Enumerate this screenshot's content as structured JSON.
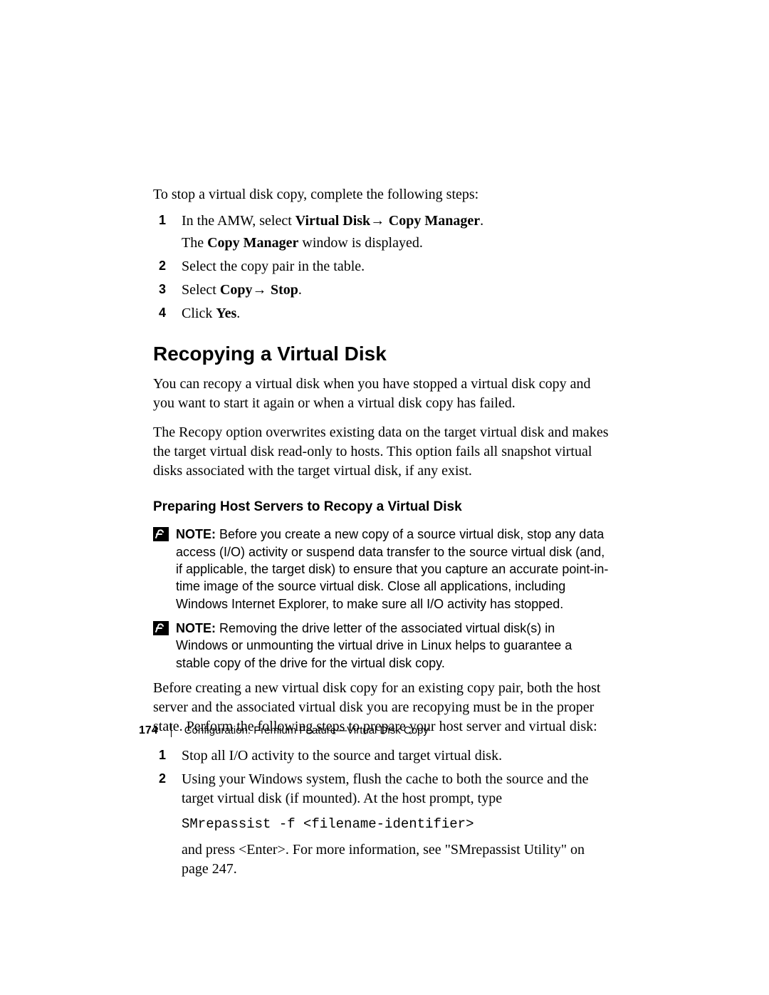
{
  "intro": "To stop a virtual disk copy, complete the following steps:",
  "steps_top": [
    {
      "num": "1",
      "runs": [
        {
          "t": "In the AMW, select "
        },
        {
          "t": "Virtual Disk",
          "b": true
        },
        {
          "t": "→ ",
          "arrow": true
        },
        {
          "t": "Copy Manager",
          "b": true
        },
        {
          "t": "."
        }
      ],
      "tail": [
        {
          "t": "The "
        },
        {
          "t": "Copy Manager",
          "b": true
        },
        {
          "t": " window is displayed."
        }
      ]
    },
    {
      "num": "2",
      "runs": [
        {
          "t": "Select the copy pair in the table."
        }
      ]
    },
    {
      "num": "3",
      "runs": [
        {
          "t": "Select "
        },
        {
          "t": "Copy",
          "b": true
        },
        {
          "t": "→ ",
          "arrow": true
        },
        {
          "t": "Stop",
          "b": true
        },
        {
          "t": "."
        }
      ]
    },
    {
      "num": "4",
      "runs": [
        {
          "t": "Click "
        },
        {
          "t": "Yes",
          "b": true
        },
        {
          "t": "."
        }
      ]
    }
  ],
  "h2": "Recopying a Virtual Disk",
  "p1": "You can recopy a virtual disk when you have stopped a virtual disk copy and you want to start it again or when a virtual disk copy has failed.",
  "p2": "The Recopy option overwrites existing data on the target virtual disk and makes the target virtual disk read-only to hosts. This option fails all snapshot virtual disks associated with the target virtual disk, if any exist.",
  "h3": "Preparing Host Servers to Recopy a Virtual Disk",
  "note1_lead": "NOTE:",
  "note1_body": " Before you create a new copy of a source virtual disk, stop any data access (I/O) activity or suspend data transfer to the source virtual disk (and, if applicable, the target disk) to ensure that you capture an accurate point-in-time image of the source virtual disk. Close all applications, including Windows Internet Explorer, to make sure all I/O activity has stopped.",
  "note2_lead": "NOTE:",
  "note2_body": " Removing the drive letter of the associated virtual disk(s) in Windows or unmounting the virtual drive in Linux helps to guarantee a stable copy of the drive for the virtual disk copy.",
  "p3": "Before creating a new virtual disk copy for an existing copy pair, both the host server and the associated virtual disk you are recopying must be in the proper state. Perform the following steps to prepare your host server and virtual disk:",
  "steps_bottom": [
    {
      "num": "1",
      "runs": [
        {
          "t": "Stop all I/O activity to the source and target virtual disk."
        }
      ]
    },
    {
      "num": "2",
      "runs": [
        {
          "t": "Using your Windows system, flush the cache to both the source and the target virtual disk (if mounted). At the host prompt, type"
        }
      ],
      "code": "SMrepassist -f <filename-identifier>",
      "after": "and press <Enter>. For more information, see \"SMrepassist Utility\" on page 247."
    }
  ],
  "footer": {
    "page": "174",
    "text": "Configuration: Premium Feature—Virtual Disk Copy"
  }
}
